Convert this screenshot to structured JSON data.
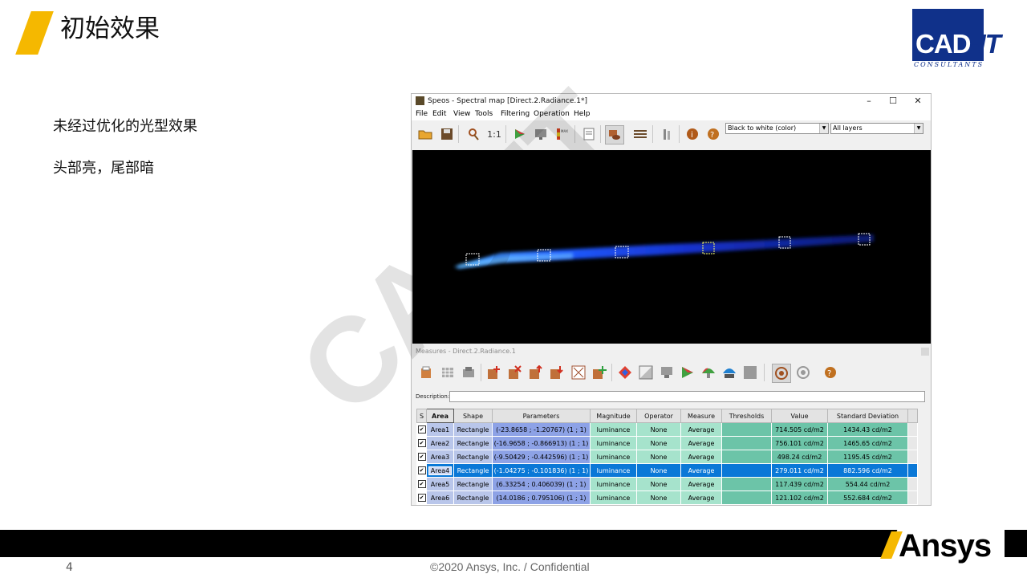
{
  "slide": {
    "title": "初始效果",
    "bullets": [
      "未经过优化的光型效果",
      "头部亮，尾部暗"
    ],
    "page_number": "4",
    "copyright": "©2020 Ansys, Inc. / Confidential",
    "watermark": "CAD-IT"
  },
  "logos": {
    "cadit_main": "CAD",
    "cadit_suffix": "IT",
    "cadit_sub": "CONSULTANTS",
    "ansys": "Ansys"
  },
  "app": {
    "window_title": "Speos - Spectral map [Direct.2.Radiance.1*]",
    "menu": [
      "File",
      "Edit",
      "View",
      "Tools",
      "Filtering",
      "Operation",
      "Help"
    ],
    "color_mode": "Black to white (color)",
    "layers": "All layers",
    "measures_title": "Measures - Direct.2.Radiance.1",
    "description_label": "Description:",
    "description_value": ""
  },
  "table": {
    "columns": [
      "S",
      "Area",
      "Shape",
      "Parameters",
      "Magnitude",
      "Operator",
      "Measure",
      "Thresholds",
      "Value",
      "Standard Deviation"
    ],
    "rows": [
      {
        "area": "Area1",
        "shape": "Rectangle",
        "params": "(-23.8658 ; -1.20767) (1 ; 1)",
        "magnitude": "luminance",
        "operator": "None",
        "measure": "Average",
        "thresholds": "",
        "value": "714.505 cd/m2",
        "std": "1434.43 cd/m2"
      },
      {
        "area": "Area2",
        "shape": "Rectangle",
        "params": "(-16.9658 ; -0.866913) (1 ; 1)",
        "magnitude": "luminance",
        "operator": "None",
        "measure": "Average",
        "thresholds": "",
        "value": "756.101 cd/m2",
        "std": "1465.65 cd/m2"
      },
      {
        "area": "Area3",
        "shape": "Rectangle",
        "params": "(-9.50429 ; -0.442596) (1 ; 1)",
        "magnitude": "luminance",
        "operator": "None",
        "measure": "Average",
        "thresholds": "",
        "value": "498.24 cd/m2",
        "std": "1195.45 cd/m2"
      },
      {
        "area": "Area4",
        "shape": "Rectangle",
        "params": "(-1.04275 ; -0.101836) (1 ; 1)",
        "magnitude": "luminance",
        "operator": "None",
        "measure": "Average",
        "thresholds": "",
        "value": "279.011 cd/m2",
        "std": "882.596 cd/m2"
      },
      {
        "area": "Area5",
        "shape": "Rectangle",
        "params": "(6.33254 ; 0.406039) (1 ; 1)",
        "magnitude": "luminance",
        "operator": "None",
        "measure": "Average",
        "thresholds": "",
        "value": "117.439 cd/m2",
        "std": "554.44 cd/m2"
      },
      {
        "area": "Area6",
        "shape": "Rectangle",
        "params": "(14.0186 ; 0.795106) (1 ; 1)",
        "magnitude": "luminance",
        "operator": "None",
        "measure": "Average",
        "thresholds": "",
        "value": "121.102 cd/m2",
        "std": "552.684 cd/m2"
      }
    ],
    "selected_row": 3
  },
  "colors": {
    "accent": "#f5b800",
    "cadit_blue": "#10318a",
    "selection": "#0a78d7"
  },
  "icons": {
    "main_toolbar": [
      "open-icon",
      "save-icon",
      "zoom-icon",
      "actual-size-icon",
      "color-palette-icon",
      "monitor-icon",
      "max-scale-icon",
      "report-icon",
      "surface-view-icon",
      "settings-sliders-icon",
      "tools-icon",
      "info-icon",
      "help-icon"
    ],
    "measures_toolbar": [
      "import-icon",
      "grid-icon",
      "export-icon",
      "add-area-icon",
      "delete-area-icon",
      "move-up-icon",
      "move-down-icon",
      "clear-icon",
      "add-measure-icon",
      "diamond-icon",
      "gradient-icon",
      "display-icon",
      "color-icon",
      "mushroom-icon",
      "lamp-icon",
      "stop-icon",
      "target-icon",
      "target-gray-icon",
      "help-icon"
    ]
  }
}
